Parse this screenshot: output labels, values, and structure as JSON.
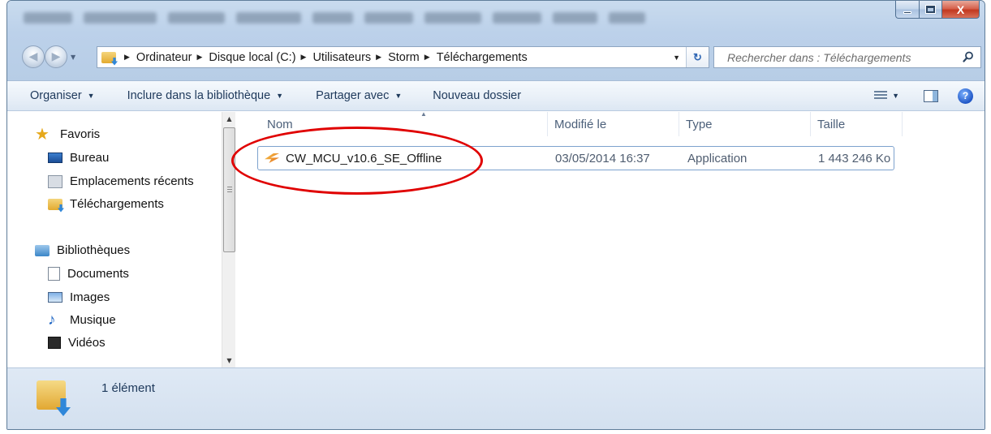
{
  "window": {
    "close_label": "X"
  },
  "address": {
    "crumbs": [
      "Ordinateur",
      "Disque local (C:)",
      "Utilisateurs",
      "Storm",
      "Téléchargements"
    ],
    "refresh_label": "↻"
  },
  "search": {
    "placeholder": "Rechercher dans : Téléchargements"
  },
  "toolbar": {
    "organize": "Organiser",
    "include": "Inclure dans la bibliothèque",
    "share": "Partager avec",
    "new_folder": "Nouveau dossier",
    "help_label": "?"
  },
  "nav": {
    "favorites": "Favoris",
    "desktop": "Bureau",
    "recent": "Emplacements récents",
    "downloads": "Téléchargements",
    "libraries": "Bibliothèques",
    "documents": "Documents",
    "images": "Images",
    "music": "Musique",
    "videos": "Vidéos"
  },
  "columns": {
    "name": "Nom",
    "modified": "Modifié le",
    "type": "Type",
    "size": "Taille"
  },
  "files": [
    {
      "name": "CW_MCU_v10.6_SE_Offline",
      "modified": "03/05/2014 16:37",
      "type": "Application",
      "size": "1 443 246 Ko"
    }
  ],
  "status": {
    "count": "1 élément"
  },
  "colors": {
    "highlight": "#e00000",
    "accent": "#1e395b"
  }
}
